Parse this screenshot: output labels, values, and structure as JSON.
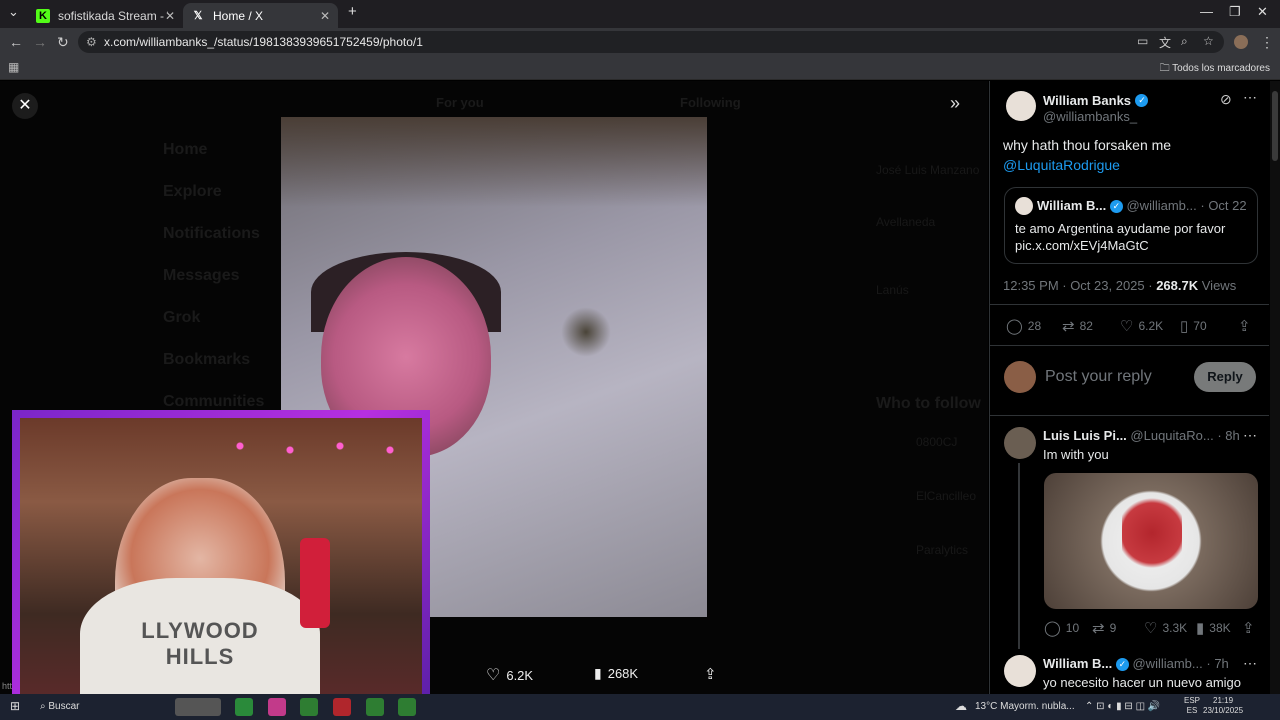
{
  "browser": {
    "tabs": [
      {
        "label": "sofistikada Stream - Watch Live",
        "icon": "kick-icon",
        "active": false
      },
      {
        "label": "Home / X",
        "icon": "x-logo-icon",
        "active": true
      }
    ],
    "url": "x.com/williambanks_/status/1981383939651752459/photo/1",
    "bookmarks_label": "Todos los marcadores"
  },
  "viewer": {
    "background_nav": {
      "for_you": "For you",
      "following": "Following",
      "items": [
        "Home",
        "Explore",
        "Notifications",
        "Messages",
        "Grok",
        "Bookmarks",
        "Communities"
      ],
      "who_to_follow": "Who to follow",
      "side_names": [
        "José Luis Manzano",
        "Avellaneda",
        "Lanús",
        "0800CJ",
        "ElCancilleo",
        "Paralytics"
      ]
    },
    "actions": {
      "likes": "6.2K",
      "views": "268K"
    }
  },
  "post": {
    "author_name": "William Banks",
    "author_handle": "@williambanks_",
    "text": "why hath thou forsaken me",
    "mention": "@LuquitaRodrigue",
    "quote": {
      "author_name": "William B...",
      "author_handle": "@williamb...",
      "date": "· Oct 22",
      "text_line1": "te amo Argentina ayudame por favor",
      "text_line2": "pic.x.com/xEVj4MaGtC"
    },
    "timestamp": "12:35 PM · Oct 23, 2025 ·",
    "views_count": "268.7K",
    "views_label": "Views",
    "stats": {
      "replies": "28",
      "reposts": "82",
      "likes": "6.2K",
      "bookmarks": "70"
    },
    "reply_placeholder": "Post your reply",
    "reply_button": "Reply"
  },
  "replies": [
    {
      "author_name": "Luis Luis Pi...",
      "author_handle": "@LuquitaRo...",
      "time": "· 8h",
      "text": "Im with you",
      "stats": {
        "replies": "10",
        "reposts": "9",
        "likes": "3.3K",
        "views": "38K"
      }
    },
    {
      "author_name": "William B...",
      "author_handle": "@williamb...",
      "time": "· 7h",
      "text": "yo necesito hacer un nuevo amigo"
    }
  ],
  "webcam": {
    "hoodie_text_line1": "LLYWOOD",
    "hoodie_text_line2": "HILLS"
  },
  "taskbar": {
    "search": "Buscar",
    "weather": "13°C  Mayorm. nubla...",
    "lang1": "ESP",
    "lang2": "ES",
    "time": "21:19",
    "date": "23/10/2025",
    "left_edge": "htt"
  }
}
